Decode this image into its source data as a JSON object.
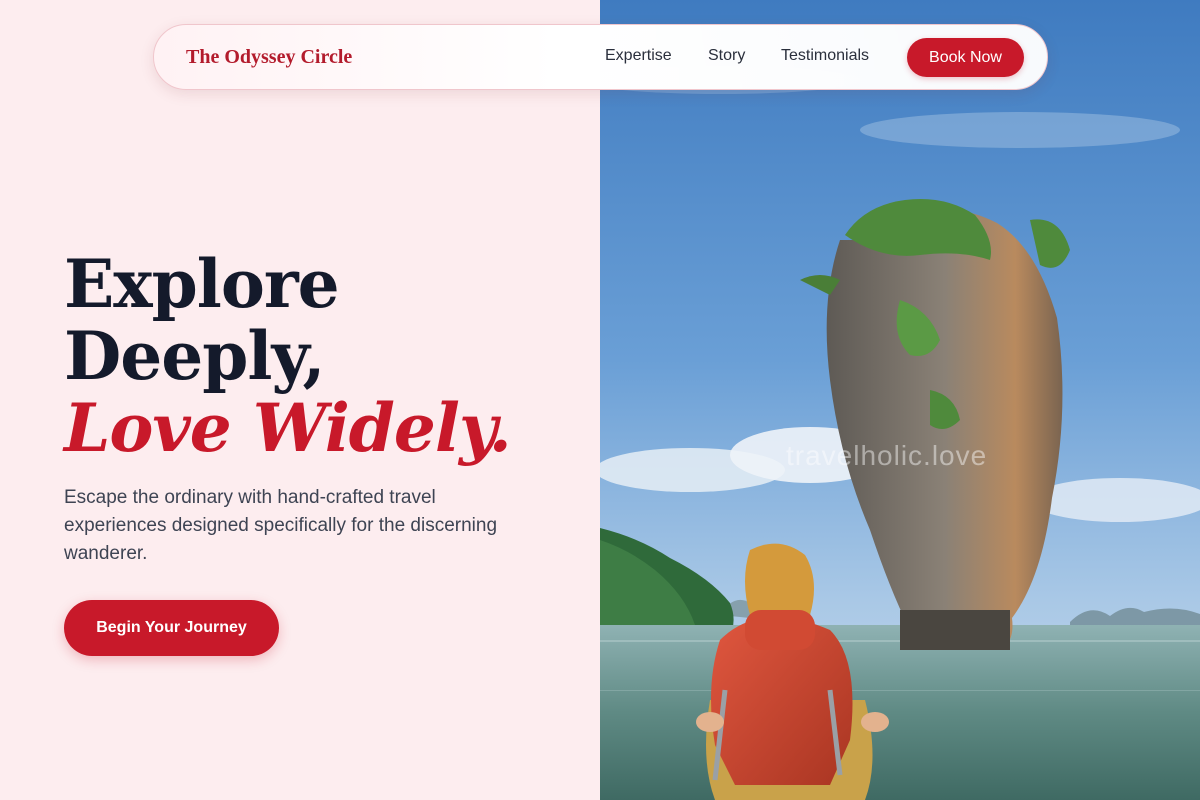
{
  "nav": {
    "brand": "The Odyssey Circle",
    "links": [
      "Expertise",
      "Story",
      "Testimonials"
    ],
    "cta_label": "Book Now"
  },
  "hero": {
    "headline_line1": "Explore",
    "headline_line2": "Deeply,",
    "headline_accent": "Love Widely.",
    "subtext": "Escape the ordinary with hand-crafted travel experiences designed specifically for the discerning wanderer.",
    "cta_label": "Begin Your Journey",
    "image_watermark": "travelholic.love"
  },
  "colors": {
    "accent": "#c8192a",
    "background": "#fdedef",
    "heading": "#141a2b"
  }
}
